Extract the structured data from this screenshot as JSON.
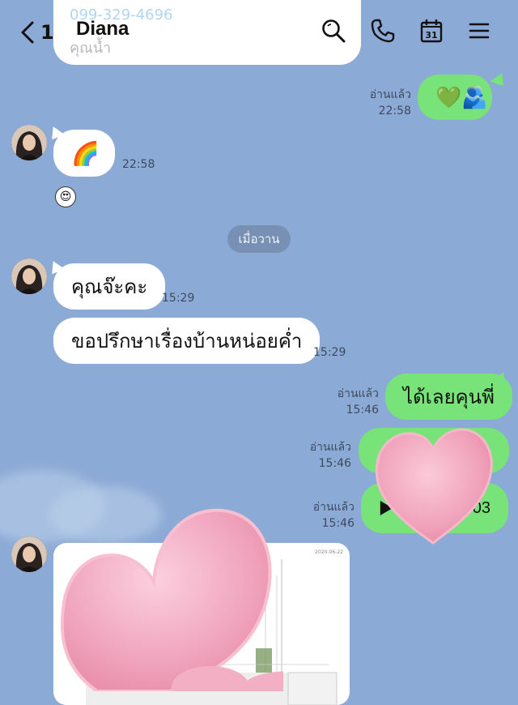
{
  "header": {
    "back_count": "1",
    "title": "Diana"
  },
  "top_message": {
    "line1": "099-329-4696",
    "line2": "คุณน้ำ"
  },
  "messages": {
    "out1": {
      "read": "อ่านแล้ว",
      "time": "22:58",
      "content": "💚🫂"
    },
    "in1": {
      "content": "🌈",
      "time": "22:58",
      "reaction": "😍"
    },
    "date_separator": "เมื่อวาน",
    "in2": {
      "text": "คุณจ๊ะคะ",
      "time": "15:29"
    },
    "in3": {
      "text": "ขอปรึกษาเรื่องบ้านหน่อยค่ำ",
      "time": "15:29"
    },
    "out2": {
      "read": "อ่านแล้ว",
      "time": "15:46",
      "text": "ได้เลยคุนพี่"
    },
    "out3": {
      "read": "อ่านแล้ว",
      "time": "15:46"
    },
    "out4": {
      "read": "อ่านแล้ว",
      "time": "15:46",
      "duration_fragment": "03"
    }
  },
  "attachment": {
    "date": "2020-06-22"
  },
  "colors": {
    "background": "#8caad6",
    "incoming_bubble": "#ffffff",
    "outgoing_bubble": "#78e378",
    "heart": "#f2a5bf"
  },
  "icons": [
    "back-icon",
    "search-icon",
    "phone-icon",
    "calendar-icon",
    "menu-icon",
    "play-icon",
    "heart-sticker-icon"
  ]
}
